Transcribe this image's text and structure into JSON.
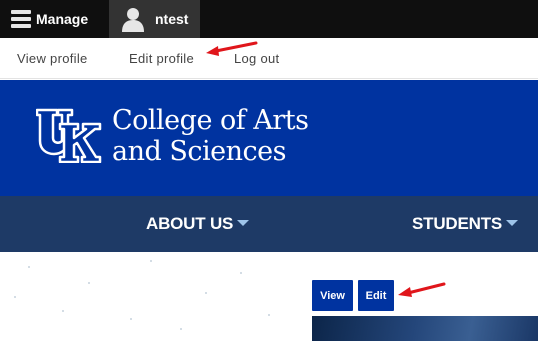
{
  "toolbar": {
    "manage_label": "Manage",
    "user_label": "ntest"
  },
  "tray": {
    "links": [
      "View profile",
      "Edit profile",
      "Log out"
    ]
  },
  "banner": {
    "logo_icon": "uk-logo-icon",
    "college_line1": "College of Arts",
    "college_line2": "and Sciences",
    "color": "#0033a0"
  },
  "main_nav": {
    "items": [
      "ABOUT US",
      "STUDENTS"
    ]
  },
  "tabs": {
    "view_label": "View",
    "edit_label": "Edit"
  },
  "colors": {
    "toolbar": "#0f0f0f",
    "nav": "#1e3a66",
    "annotation_arrow": "#e0161b"
  }
}
